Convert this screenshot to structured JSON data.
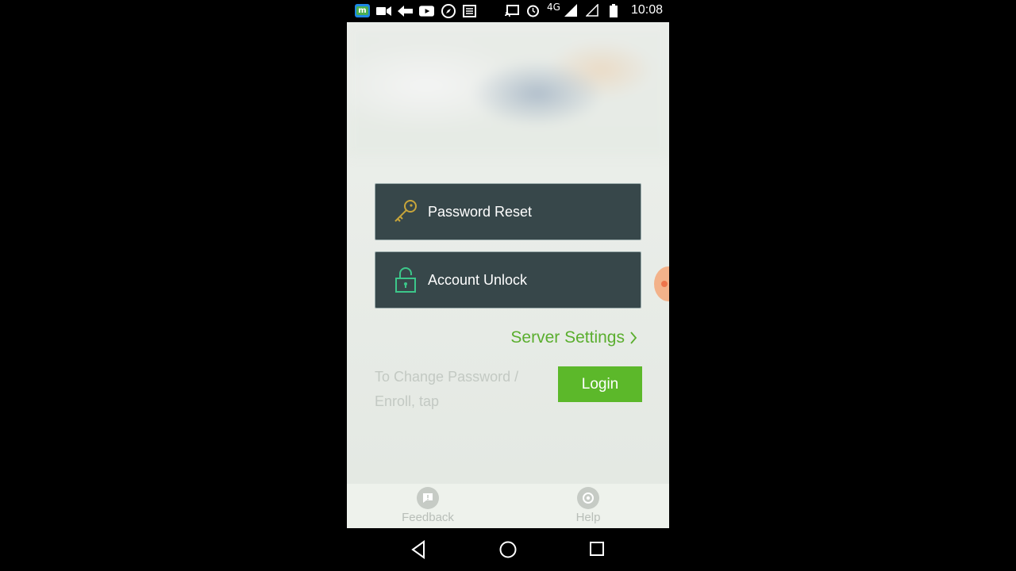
{
  "status_bar": {
    "network_label": "4G",
    "time": "10:08",
    "icons": [
      "app-m-icon",
      "video-camera-icon",
      "arrow-icon",
      "youtube-icon",
      "compass-icon",
      "news-icon",
      "cast-icon",
      "alarm-icon",
      "signal-icon",
      "signal-empty-icon",
      "battery-icon"
    ]
  },
  "actions": {
    "password_reset": "Password Reset",
    "account_unlock": "Account Unlock"
  },
  "server_settings": "Server Settings",
  "change_text": "To Change Password / Enroll, tap",
  "login_label": "Login",
  "bottom_tabs": {
    "feedback": "Feedback",
    "help": "Help"
  },
  "colors": {
    "accent_green": "#5cb82a",
    "dark_button": "#37474a",
    "key_icon": "#c8a53a",
    "lock_icon": "#3cc78a"
  }
}
